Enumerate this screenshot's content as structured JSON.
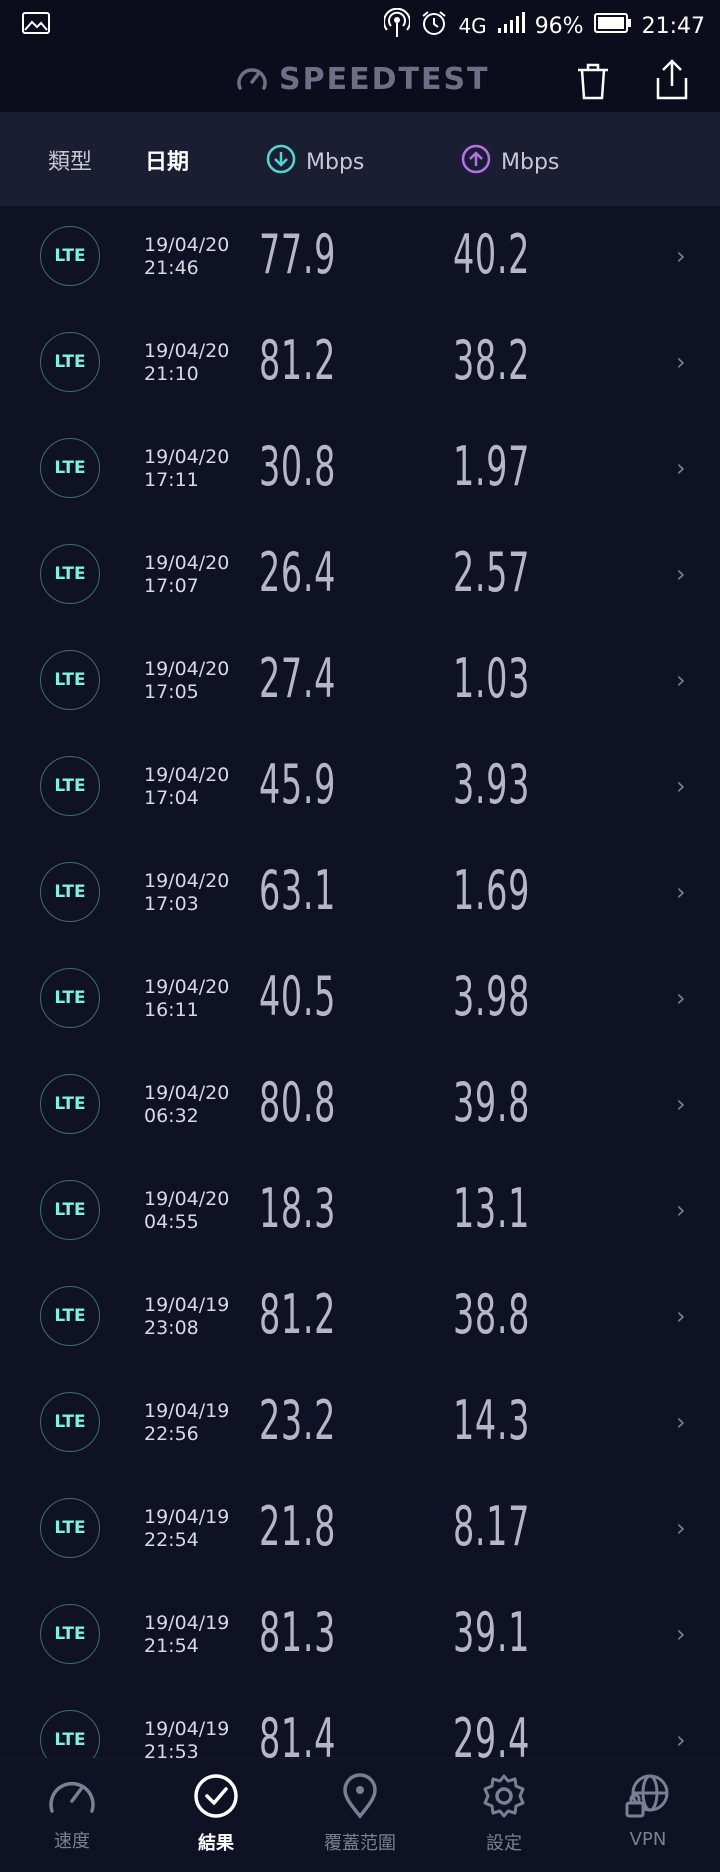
{
  "statusbar": {
    "left_icon": "image-icon",
    "network": "4G",
    "battery": "96%",
    "time": "21:47"
  },
  "appbar": {
    "logo": "SPEEDTEST",
    "icons": [
      "gauge-icon",
      "trash-icon",
      "share-icon"
    ]
  },
  "columns": {
    "type": "類型",
    "date": "日期",
    "download_unit": "Mbps",
    "upload_unit": "Mbps"
  },
  "results": [
    {
      "type": "LTE",
      "date": "19/04/20",
      "time": "21:46",
      "download": "77.9",
      "upload": "40.2"
    },
    {
      "type": "LTE",
      "date": "19/04/20",
      "time": "21:10",
      "download": "81.2",
      "upload": "38.2"
    },
    {
      "type": "LTE",
      "date": "19/04/20",
      "time": "17:11",
      "download": "30.8",
      "upload": "1.97"
    },
    {
      "type": "LTE",
      "date": "19/04/20",
      "time": "17:07",
      "download": "26.4",
      "upload": "2.57"
    },
    {
      "type": "LTE",
      "date": "19/04/20",
      "time": "17:05",
      "download": "27.4",
      "upload": "1.03"
    },
    {
      "type": "LTE",
      "date": "19/04/20",
      "time": "17:04",
      "download": "45.9",
      "upload": "3.93"
    },
    {
      "type": "LTE",
      "date": "19/04/20",
      "time": "17:03",
      "download": "63.1",
      "upload": "1.69"
    },
    {
      "type": "LTE",
      "date": "19/04/20",
      "time": "16:11",
      "download": "40.5",
      "upload": "3.98"
    },
    {
      "type": "LTE",
      "date": "19/04/20",
      "time": "06:32",
      "download": "80.8",
      "upload": "39.8"
    },
    {
      "type": "LTE",
      "date": "19/04/20",
      "time": "04:55",
      "download": "18.3",
      "upload": "13.1"
    },
    {
      "type": "LTE",
      "date": "19/04/19",
      "time": "23:08",
      "download": "81.2",
      "upload": "38.8"
    },
    {
      "type": "LTE",
      "date": "19/04/19",
      "time": "22:56",
      "download": "23.2",
      "upload": "14.3"
    },
    {
      "type": "LTE",
      "date": "19/04/19",
      "time": "22:54",
      "download": "21.8",
      "upload": "8.17"
    },
    {
      "type": "LTE",
      "date": "19/04/19",
      "time": "21:54",
      "download": "81.3",
      "upload": "39.1"
    },
    {
      "type": "LTE",
      "date": "19/04/19",
      "time": "21:53",
      "download": "81.4",
      "upload": "29.4"
    }
  ],
  "nav": {
    "speed": "速度",
    "results": "結果",
    "coverage": "覆蓋范圍",
    "settings": "設定",
    "vpn": "VPN"
  },
  "colors": {
    "background": "#0f1124",
    "header": "#1b1e33",
    "download": "#4fd6d0",
    "upload": "#b373e6",
    "badge_text": "#7ff2df"
  }
}
